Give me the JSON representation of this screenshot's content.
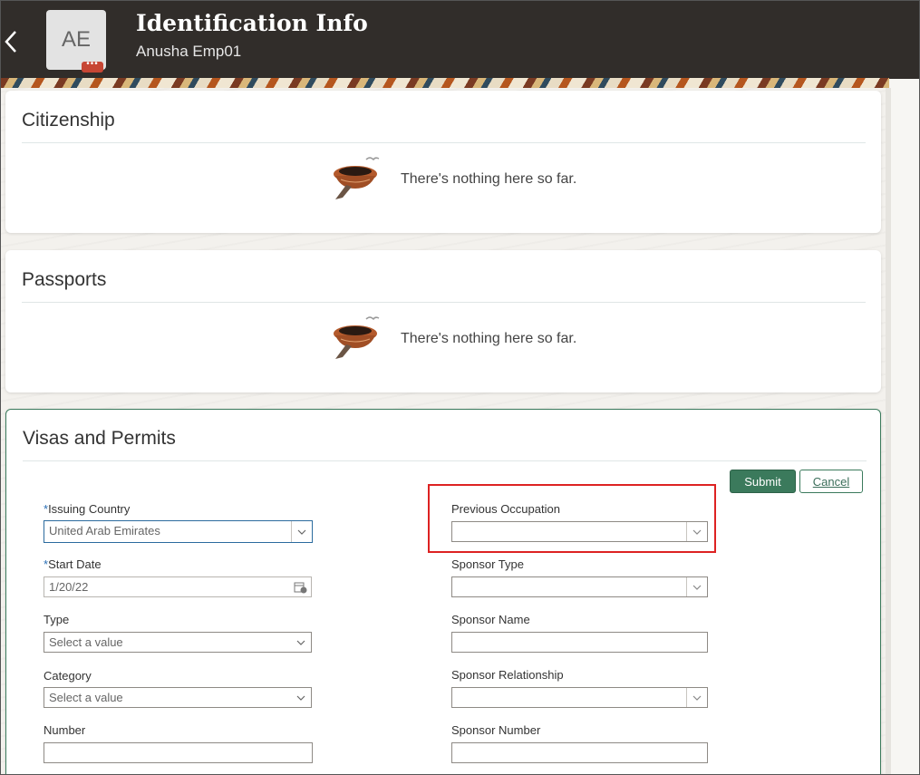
{
  "header": {
    "title": "Identification Info",
    "subtitle": "Anusha Emp01",
    "avatar_initials": "AE",
    "avatar_badge": "•••",
    "back_icon": "chevron-left-icon"
  },
  "citizenship": {
    "title": "Citizenship",
    "empty_text": "There's nothing here so far."
  },
  "passports": {
    "title": "Passports",
    "empty_text": "There's nothing here so far."
  },
  "visas": {
    "title": "Visas and Permits",
    "submit_label": "Submit",
    "cancel_label": "Cancel",
    "required_mark": "*",
    "fields": {
      "issuing_country": {
        "label": "Issuing Country",
        "value": "United Arab Emirates"
      },
      "start_date": {
        "label": "Start Date",
        "value": "1/20/22"
      },
      "type": {
        "label": "Type",
        "placeholder": "Select a value"
      },
      "category": {
        "label": "Category",
        "placeholder": "Select a value"
      },
      "number": {
        "label": "Number",
        "value": ""
      },
      "previous_occupation": {
        "label": "Previous Occupation",
        "value": ""
      },
      "sponsor_type": {
        "label": "Sponsor Type",
        "value": ""
      },
      "sponsor_name": {
        "label": "Sponsor Name",
        "value": ""
      },
      "sponsor_relationship": {
        "label": "Sponsor Relationship",
        "value": ""
      },
      "sponsor_number": {
        "label": "Sponsor Number",
        "value": ""
      }
    }
  },
  "colors": {
    "header_bg": "#312d2a",
    "primary_button": "#3b7a5c",
    "highlight_box": "#dd2222",
    "required_mark": "#2a6fb5"
  }
}
